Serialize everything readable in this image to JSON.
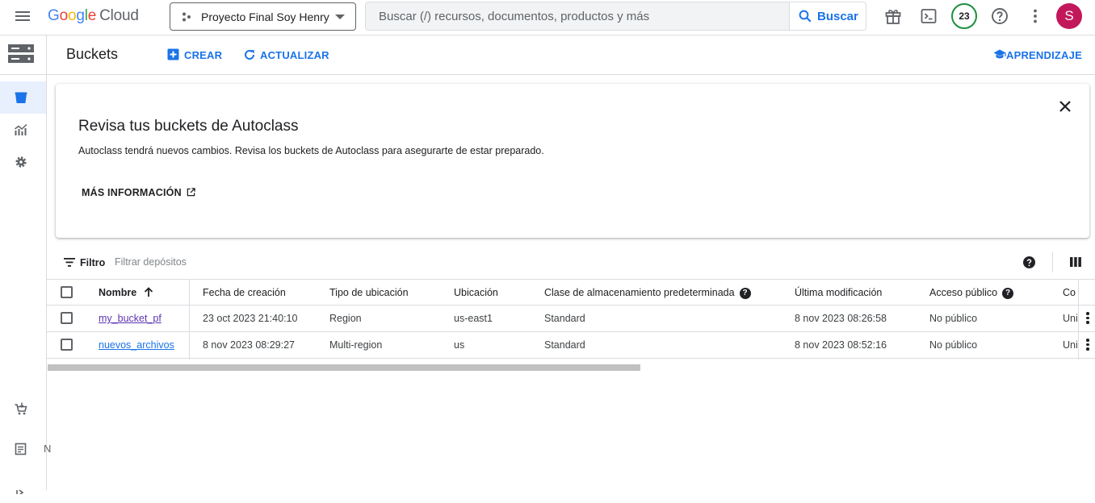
{
  "topbar": {
    "logo": {
      "g1": "G",
      "g2": "o",
      "g3": "o",
      "g4": "g",
      "g5": "l",
      "g6": "e",
      "cloud": "Cloud"
    },
    "project_name": "Proyecto Final Soy Henry",
    "search_placeholder": "Buscar (/) recursos, documentos, productos y más",
    "search_button": "Buscar",
    "notifications_count": "23",
    "avatar_letter": "S"
  },
  "header": {
    "title": "Buckets",
    "create_label": "CREAR",
    "refresh_label": "ACTUALIZAR",
    "learn_label": "APRENDIZAJE"
  },
  "banner": {
    "title": "Revisa tus buckets de Autoclass",
    "text": "Autoclass tendrá nuevos cambios. Revisa los buckets de Autoclass para asegurarte de estar preparado.",
    "link_label": "MÁS INFORMACIÓN"
  },
  "filter": {
    "label": "Filtro",
    "placeholder": "Filtrar depósitos"
  },
  "table": {
    "headers": {
      "name": "Nombre",
      "created": "Fecha de creación",
      "location_type": "Tipo de ubicación",
      "location": "Ubicación",
      "storage_class": "Clase de almacenamiento predeterminada",
      "modified": "Última modificación",
      "public_access": "Acceso público",
      "protection": "Co"
    },
    "rows": [
      {
        "name": "my_bucket_pf",
        "created": "23 oct 2023 21:40:10",
        "location_type": "Region",
        "location": "us-east1",
        "storage_class": "Standard",
        "modified": "8 nov 2023 08:26:58",
        "public_access": "No público",
        "protection": "Uni"
      },
      {
        "name": "nuevos_archivos",
        "created": "8 nov 2023 08:29:27",
        "location_type": "Multi-region",
        "location": "us",
        "storage_class": "Standard",
        "modified": "8 nov 2023 08:52:16",
        "public_access": "No público",
        "protection": "Uni"
      }
    ]
  },
  "rail": {
    "truncated_label": "N"
  },
  "colors": {
    "accent": "#1a73e8",
    "avatar": "#c2185b",
    "badge_ring": "#1e8e3e",
    "link_visited": "#5e35b1"
  }
}
